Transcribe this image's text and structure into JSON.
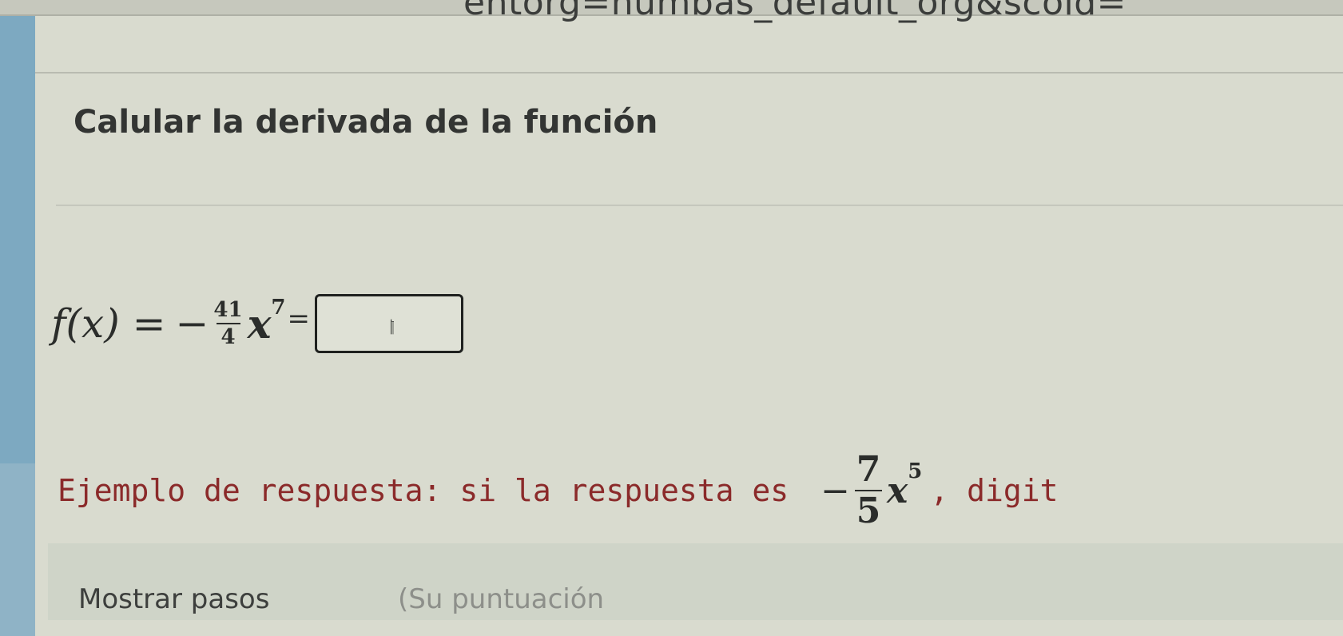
{
  "browser": {
    "url_fragment": "entorg=numbas_default_org&scoid="
  },
  "question": {
    "title": "Calular la derivada de la función"
  },
  "equation": {
    "lhs": "f(x) =",
    "sign": "−",
    "numerator": "41",
    "denominator": "4",
    "variable": "x",
    "exponent": "7",
    "equals": "=",
    "answer_value": ""
  },
  "example": {
    "text": "Ejemplo de respuesta: si la respuesta es",
    "math_sign": "−",
    "math_numerator": "7",
    "math_denominator": "5",
    "math_variable": "x",
    "math_exponent": "5",
    "tail": ", digit"
  },
  "steps": {
    "button_label": "Mostrar pasos",
    "score_text": "(Su puntuación"
  },
  "colors": {
    "background": "#d9dbcf",
    "example_text": "#8b2a2a",
    "left_stripe": "#7da9c1"
  },
  "icons": {
    "cursor": "text-cursor-icon"
  }
}
